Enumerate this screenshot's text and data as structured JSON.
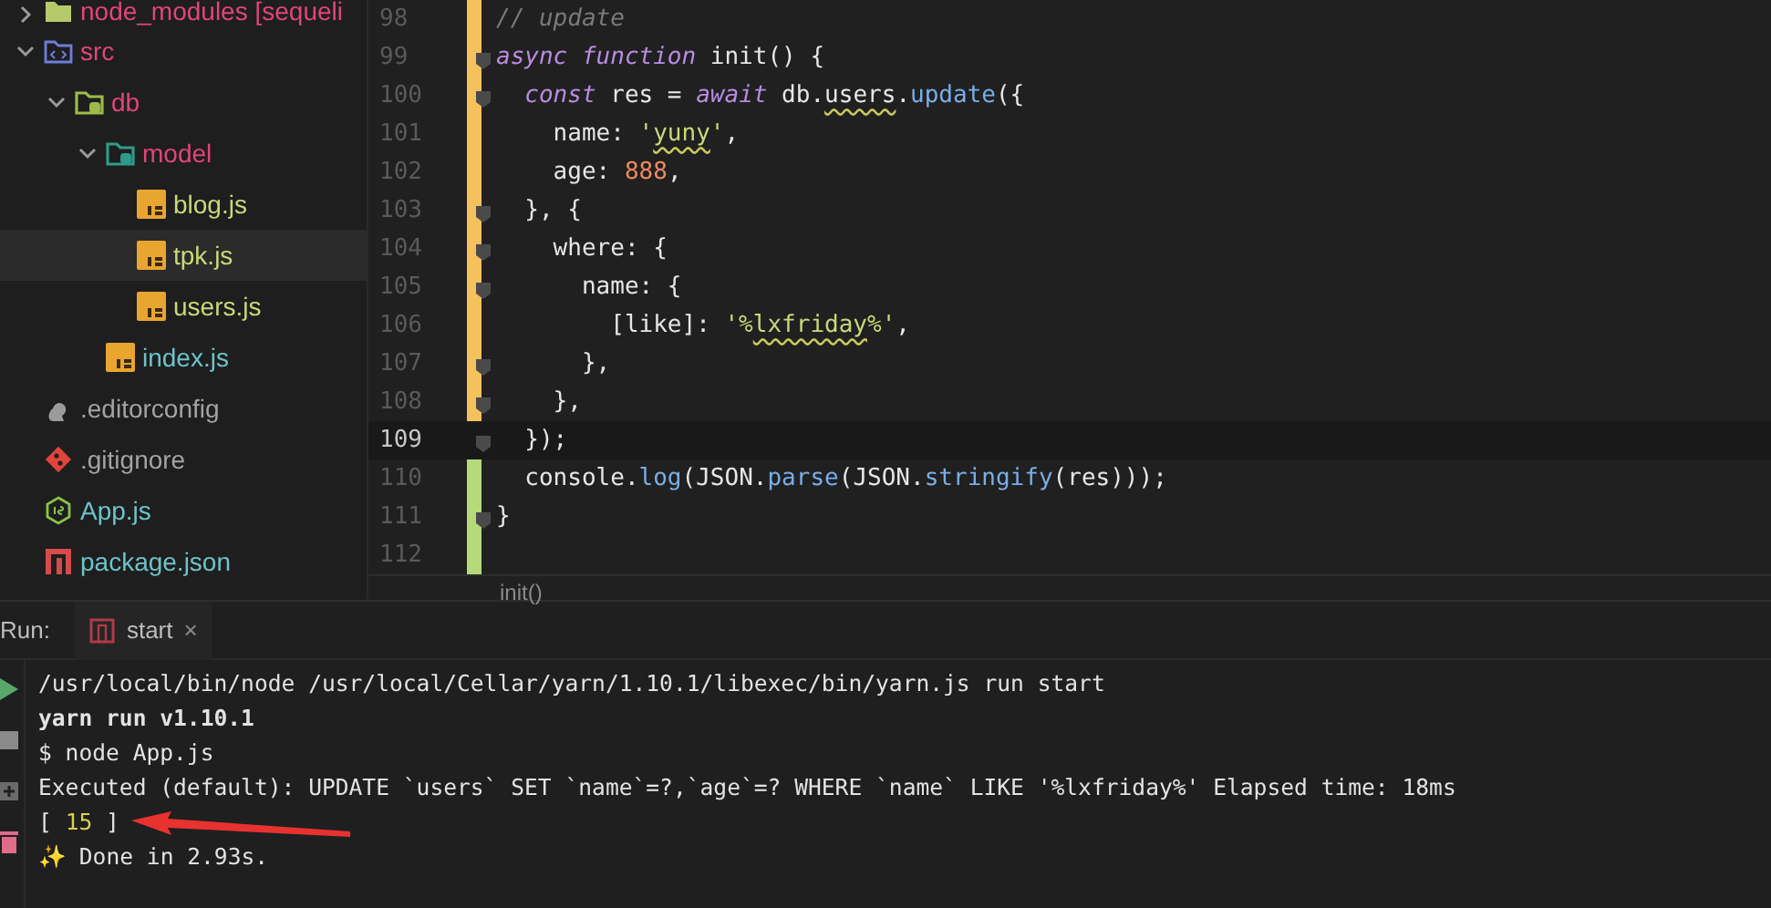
{
  "project_tree": [
    {
      "label": "node_modules [sequeli",
      "kind": "module",
      "color": "#e0457b",
      "expanded": false,
      "selected": false
    },
    {
      "label": "src",
      "kind": "code",
      "color": "#e0457b",
      "expanded": true,
      "selected": false,
      "children": [
        {
          "label": "db",
          "kind": "database",
          "color": "#e0457b",
          "expanded": true,
          "selected": false,
          "children": [
            {
              "label": "model",
              "kind": "model",
              "color": "#e0457b",
              "expanded": true,
              "selected": false,
              "children": [
                {
                  "label": "blog.js",
                  "kind": "js",
                  "color": "#c8d977",
                  "selected": false
                },
                {
                  "label": "tpk.js",
                  "kind": "js",
                  "color": "#c8d977",
                  "selected": true
                },
                {
                  "label": "users.js",
                  "kind": "js",
                  "color": "#c8d977",
                  "selected": false
                }
              ]
            },
            {
              "label": "index.js",
              "kind": "js",
              "color": "#6cc3c9",
              "selected": false
            }
          ]
        }
      ]
    },
    {
      "label": ".editorconfig",
      "kind": "config",
      "color": "#a3a3a3",
      "selected": false
    },
    {
      "label": ".gitignore",
      "kind": "git",
      "color": "#a3a3a3",
      "selected": false
    },
    {
      "label": "App.js",
      "kind": "node",
      "color": "#6cc3c9",
      "selected": false
    },
    {
      "label": "package.json",
      "kind": "npm",
      "color": "#6cc3c9",
      "selected": false
    }
  ],
  "editor": {
    "lines": [
      {
        "number": "98",
        "color": "#f5c15c",
        "fold": false,
        "current": false,
        "tokens": [
          {
            "text": "// update",
            "kind": "comment"
          }
        ]
      },
      {
        "number": "99",
        "color": "#f5c15c",
        "fold": true,
        "current": false,
        "tokens": [
          {
            "text": "async function",
            "kind": "keyword"
          },
          {
            "text": " init() {",
            "kind": "plain"
          }
        ]
      },
      {
        "number": "100",
        "color": "#f5c15c",
        "fold": true,
        "current": false,
        "tokens": [
          {
            "text": "  const",
            "kind": "keyword"
          },
          {
            "text": " res = ",
            "kind": "plain"
          },
          {
            "text": "await",
            "kind": "keyword"
          },
          {
            "text": " db.",
            "kind": "plain"
          },
          {
            "text": "users",
            "kind": "plain",
            "squiggle": true
          },
          {
            "text": ".",
            "kind": "plain"
          },
          {
            "text": "update",
            "kind": "method"
          },
          {
            "text": "({",
            "kind": "plain"
          }
        ]
      },
      {
        "number": "101",
        "color": "#f5c15c",
        "fold": false,
        "current": false,
        "tokens": [
          {
            "text": "    name: ",
            "kind": "plain"
          },
          {
            "text": "'",
            "kind": "string"
          },
          {
            "text": "yuny",
            "kind": "string",
            "squiggle": true
          },
          {
            "text": "'",
            "kind": "string"
          },
          {
            "text": ",",
            "kind": "plain"
          }
        ]
      },
      {
        "number": "102",
        "color": "#f5c15c",
        "fold": false,
        "current": false,
        "tokens": [
          {
            "text": "    age: ",
            "kind": "plain"
          },
          {
            "text": "888",
            "kind": "number"
          },
          {
            "text": ",",
            "kind": "plain"
          }
        ]
      },
      {
        "number": "103",
        "color": "#f5c15c",
        "fold": true,
        "current": false,
        "tokens": [
          {
            "text": "  }, {",
            "kind": "plain"
          }
        ]
      },
      {
        "number": "104",
        "color": "#f5c15c",
        "fold": true,
        "current": false,
        "tokens": [
          {
            "text": "    where: {",
            "kind": "plain"
          }
        ]
      },
      {
        "number": "105",
        "color": "#f5c15c",
        "fold": true,
        "current": false,
        "tokens": [
          {
            "text": "      name: {",
            "kind": "plain"
          }
        ]
      },
      {
        "number": "106",
        "color": "#f5c15c",
        "fold": false,
        "current": false,
        "tokens": [
          {
            "text": "        [like]: ",
            "kind": "plain"
          },
          {
            "text": "'%",
            "kind": "string"
          },
          {
            "text": "lxfriday",
            "kind": "string",
            "squiggle": true
          },
          {
            "text": "%'",
            "kind": "string"
          },
          {
            "text": ",",
            "kind": "plain"
          }
        ]
      },
      {
        "number": "107",
        "color": "#f5c15c",
        "fold": true,
        "current": false,
        "tokens": [
          {
            "text": "      },",
            "kind": "plain"
          }
        ]
      },
      {
        "number": "108",
        "color": "#f5c15c",
        "fold": true,
        "current": false,
        "tokens": [
          {
            "text": "    },",
            "kind": "plain"
          }
        ]
      },
      {
        "number": "109",
        "fold": true,
        "current": true,
        "tokens": [
          {
            "text": "  });",
            "kind": "plain"
          }
        ]
      },
      {
        "number": "110",
        "color": "#b6d97a",
        "fold": false,
        "current": false,
        "tokens": [
          {
            "text": "  console.",
            "kind": "plain"
          },
          {
            "text": "log",
            "kind": "method"
          },
          {
            "text": "(JSON.",
            "kind": "plain"
          },
          {
            "text": "parse",
            "kind": "method"
          },
          {
            "text": "(JSON.",
            "kind": "plain"
          },
          {
            "text": "stringify",
            "kind": "method"
          },
          {
            "text": "(res)));",
            "kind": "plain"
          }
        ]
      },
      {
        "number": "111",
        "color": "#b6d97a",
        "fold": true,
        "current": false,
        "tokens": [
          {
            "text": "}",
            "kind": "plain"
          }
        ]
      },
      {
        "number": "112",
        "color": "#b6d97a",
        "fold": false,
        "current": false
      }
    ],
    "breadcrumb": "init()"
  },
  "run_panel": {
    "label": "Run:",
    "tabs": [
      {
        "label": "start",
        "close": "×",
        "selected": true
      }
    ],
    "output": [
      {
        "kind": "plain",
        "tokens": [
          {
            "text": "/usr/local/bin/node /usr/local/Cellar/yarn/1.10.1/libexec/bin/yarn.js run start",
            "kind": "plain"
          }
        ]
      },
      {
        "kind": "bold",
        "tokens": [
          {
            "text": "yarn run v1.10.1",
            "kind": "plain"
          }
        ]
      },
      {
        "kind": "plain",
        "tokens": [
          {
            "text": "$ node App.js",
            "kind": "plain"
          }
        ]
      },
      {
        "kind": "plain",
        "tokens": [
          {
            "text": "Executed (default): UPDATE `users` SET `name`=?,`age`=? WHERE `name` LIKE '%lxfriday%' Elapsed time: 18ms",
            "kind": "plain"
          }
        ]
      },
      {
        "kind": "plain",
        "tokens": [
          {
            "text": "[ ",
            "kind": "plain"
          },
          {
            "text": "15",
            "kind": "number"
          },
          {
            "text": " ]",
            "kind": "plain"
          }
        ]
      },
      {
        "kind": "plain",
        "tokens": [
          {
            "text": "✨ Done in 2.93s.",
            "kind": "plain"
          }
        ]
      }
    ]
  }
}
